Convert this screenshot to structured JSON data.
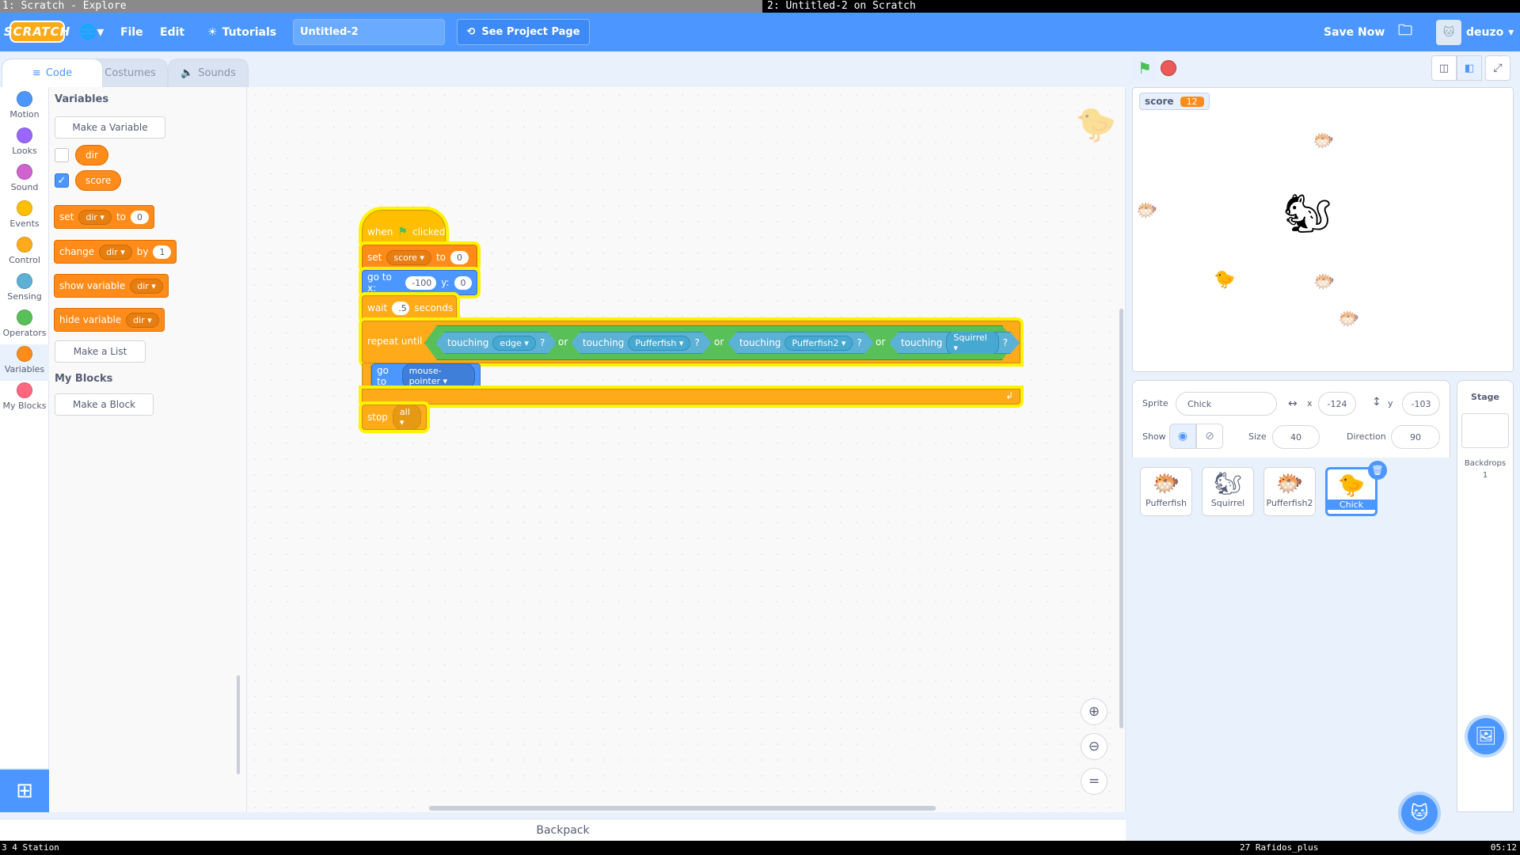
{
  "window": {
    "left_title": "1: Scratch - Explore",
    "right_title": "2: Untitled-2 on Scratch"
  },
  "menubar": {
    "logo": "SCRATCH",
    "file": "File",
    "edit": "Edit",
    "tutorials": "Tutorials",
    "project_title": "Untitled-2",
    "see_project": "See Project Page",
    "save_now": "Save Now",
    "username": "deuzo"
  },
  "tabs": {
    "code": "Code",
    "costumes": "Costumes",
    "sounds": "Sounds"
  },
  "categories": [
    {
      "label": "Motion",
      "color": "#4c97ff"
    },
    {
      "label": "Looks",
      "color": "#9966ff"
    },
    {
      "label": "Sound",
      "color": "#cf63cf"
    },
    {
      "label": "Events",
      "color": "#ffbf00"
    },
    {
      "label": "Control",
      "color": "#ffab19"
    },
    {
      "label": "Sensing",
      "color": "#5cb1d6"
    },
    {
      "label": "Operators",
      "color": "#59c059"
    },
    {
      "label": "Variables",
      "color": "#ff8c1a"
    },
    {
      "label": "My Blocks",
      "color": "#ff6680"
    }
  ],
  "palette": {
    "variables_heading": "Variables",
    "make_variable": "Make a Variable",
    "var_dir": "dir",
    "var_score": "score",
    "set_block": {
      "label": "set",
      "var": "dir",
      "to": "to",
      "value": "0"
    },
    "change_block": {
      "label": "change",
      "var": "dir",
      "by": "by",
      "value": "1"
    },
    "show_block": {
      "label": "show variable",
      "var": "dir"
    },
    "hide_block": {
      "label": "hide variable",
      "var": "dir"
    },
    "make_list": "Make a List",
    "myblocks_heading": "My Blocks",
    "make_block": "Make a Block"
  },
  "script": {
    "when": "when",
    "clicked": "clicked",
    "set": "set",
    "set_var": "score",
    "set_to": "to",
    "set_value": "0",
    "goto": "go to x:",
    "x": "-100",
    "y_label": "y:",
    "y": "0",
    "wait": "wait",
    "wait_value": ".5",
    "seconds": "seconds",
    "repeat_until": "repeat until",
    "touching": "touching",
    "t1": "edge",
    "t2": "Pufferfish",
    "t3": "Pufferfish2",
    "t4": "Squirrel",
    "or": "or",
    "q": "?",
    "goto_target_label": "go to",
    "goto_target": "mouse-pointer",
    "stop": "stop",
    "stop_value": "all"
  },
  "backpack": "Backpack",
  "stage": {
    "monitor_label": "score",
    "monitor_value": "12"
  },
  "sprite_info": {
    "sprite_label": "Sprite",
    "sprite_name": "Chick",
    "x_label": "x",
    "x": "-124",
    "y_label": "y",
    "y": "-103",
    "show_label": "Show",
    "size_label": "Size",
    "size": "40",
    "direction_label": "Direction",
    "direction": "90"
  },
  "sprites": [
    {
      "name": "Pufferfish",
      "icon": "🐡"
    },
    {
      "name": "Squirrel",
      "icon": "🐿"
    },
    {
      "name": "Pufferfish2",
      "icon": "🐡"
    },
    {
      "name": "Chick",
      "icon": "🐤"
    }
  ],
  "stage_panel": {
    "label": "Stage",
    "backdrops_label": "Backdrops",
    "backdrops_count": "1"
  },
  "statusbar": {
    "left": "3  4  Station",
    "mid": "27 Rafidos_plus",
    "time": "05:12"
  }
}
